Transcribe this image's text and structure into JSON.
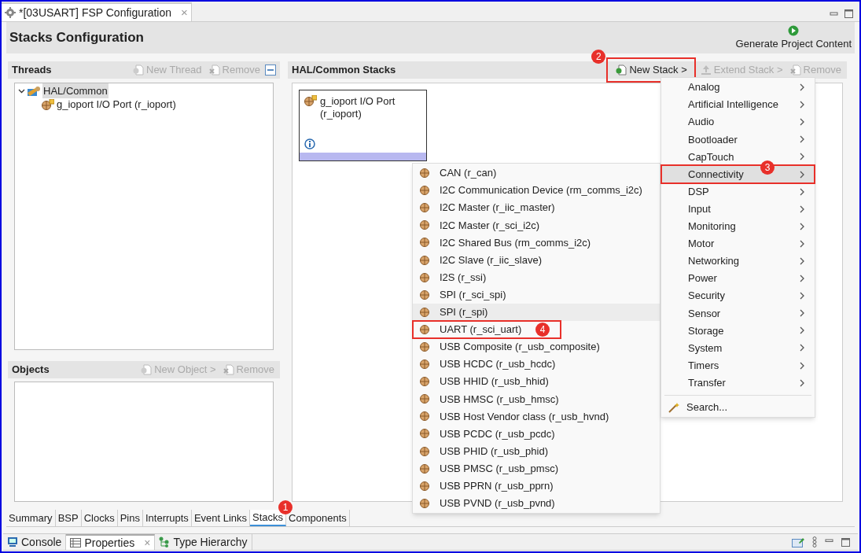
{
  "editor_tab": {
    "title": "*[03USART] FSP Configuration",
    "close": "×"
  },
  "header": {
    "title": "Stacks Configuration",
    "action": "Generate Project Content"
  },
  "threads": {
    "title": "Threads",
    "buttons": [
      {
        "label": "New Thread",
        "disabled": true
      },
      {
        "label": "Remove",
        "disabled": true
      }
    ],
    "tree": [
      {
        "label": "HAL/Common",
        "selected": true,
        "expanded": true,
        "children": [
          {
            "label": "g_ioport I/O Port (r_ioport)",
            "selected": false
          }
        ]
      }
    ]
  },
  "objects": {
    "title": "Objects",
    "buttons": [
      {
        "label": "New Object >",
        "disabled": true
      },
      {
        "label": "Remove",
        "disabled": true
      }
    ]
  },
  "stacks": {
    "title": "HAL/Common Stacks",
    "buttons": [
      {
        "label": "New Stack >",
        "disabled": false,
        "callout": "2"
      },
      {
        "label": "Extend Stack >",
        "disabled": true
      },
      {
        "label": "Remove",
        "disabled": true
      }
    ],
    "cards": [
      {
        "line_1": "g_ioport I/O Port",
        "line_2": "(r_ioport)"
      }
    ]
  },
  "category_menu": [
    {
      "label": "Analog",
      "kind": "submenu",
      "selected": false
    },
    {
      "label": "Artificial Intelligence",
      "kind": "submenu",
      "selected": false
    },
    {
      "label": "Audio",
      "kind": "submenu",
      "selected": false
    },
    {
      "label": "Bootloader",
      "kind": "submenu",
      "selected": false
    },
    {
      "label": "CapTouch",
      "kind": "submenu",
      "selected": false
    },
    {
      "label": "Connectivity",
      "kind": "submenu",
      "selected": true,
      "callout": "3"
    },
    {
      "label": "DSP",
      "kind": "submenu",
      "selected": false
    },
    {
      "label": "Input",
      "kind": "submenu",
      "selected": false
    },
    {
      "label": "Monitoring",
      "kind": "submenu",
      "selected": false
    },
    {
      "label": "Motor",
      "kind": "submenu",
      "selected": false
    },
    {
      "label": "Networking",
      "kind": "submenu",
      "selected": false
    },
    {
      "label": "Power",
      "kind": "submenu",
      "selected": false
    },
    {
      "label": "Security",
      "kind": "submenu",
      "selected": false
    },
    {
      "label": "Sensor",
      "kind": "submenu",
      "selected": false
    },
    {
      "label": "Storage",
      "kind": "submenu",
      "selected": false
    },
    {
      "label": "System",
      "kind": "submenu",
      "selected": false
    },
    {
      "label": "Timers",
      "kind": "submenu",
      "selected": false
    },
    {
      "label": "Transfer",
      "kind": "submenu",
      "selected": false
    },
    {
      "label": "Search...",
      "kind": "search",
      "selected": false
    }
  ],
  "connectivity_menu": [
    {
      "label": "CAN (r_can)",
      "selected": false
    },
    {
      "label": "I2C Communication Device (rm_comms_i2c)",
      "selected": false
    },
    {
      "label": "I2C Master (r_iic_master)",
      "selected": false
    },
    {
      "label": "I2C Master (r_sci_i2c)",
      "selected": false
    },
    {
      "label": "I2C Shared Bus (rm_comms_i2c)",
      "selected": false
    },
    {
      "label": "I2C Slave (r_iic_slave)",
      "selected": false
    },
    {
      "label": "I2S (r_ssi)",
      "selected": false
    },
    {
      "label": "SPI (r_sci_spi)",
      "selected": false
    },
    {
      "label": "SPI (r_spi)",
      "selected": true
    },
    {
      "label": "UART (r_sci_uart)",
      "selected": false,
      "callout": "4"
    },
    {
      "label": "USB Composite (r_usb_composite)",
      "selected": false
    },
    {
      "label": "USB HCDC (r_usb_hcdc)",
      "selected": false
    },
    {
      "label": "USB HHID (r_usb_hhid)",
      "selected": false
    },
    {
      "label": "USB HMSC (r_usb_hmsc)",
      "selected": false
    },
    {
      "label": "USB Host Vendor class (r_usb_hvnd)",
      "selected": false
    },
    {
      "label": "USB PCDC (r_usb_pcdc)",
      "selected": false
    },
    {
      "label": "USB PHID (r_usb_phid)",
      "selected": false
    },
    {
      "label": "USB PMSC (r_usb_pmsc)",
      "selected": false
    },
    {
      "label": "USB PPRN (r_usb_pprn)",
      "selected": false
    },
    {
      "label": "USB PVND (r_usb_pvnd)",
      "selected": false
    }
  ],
  "page_tabs": [
    {
      "label": "Summary",
      "selected": false
    },
    {
      "label": "BSP",
      "selected": false
    },
    {
      "label": "Clocks",
      "selected": false
    },
    {
      "label": "Pins",
      "selected": false
    },
    {
      "label": "Interrupts",
      "selected": false
    },
    {
      "label": "Event Links",
      "selected": false
    },
    {
      "label": "Stacks",
      "selected": true,
      "callout": "1"
    },
    {
      "label": "Components",
      "selected": false
    }
  ],
  "view_tabs": [
    {
      "label": "Console",
      "selected": false
    },
    {
      "label": "Properties",
      "selected": true,
      "close": "×"
    },
    {
      "label": "Type Hierarchy",
      "selected": false
    }
  ]
}
